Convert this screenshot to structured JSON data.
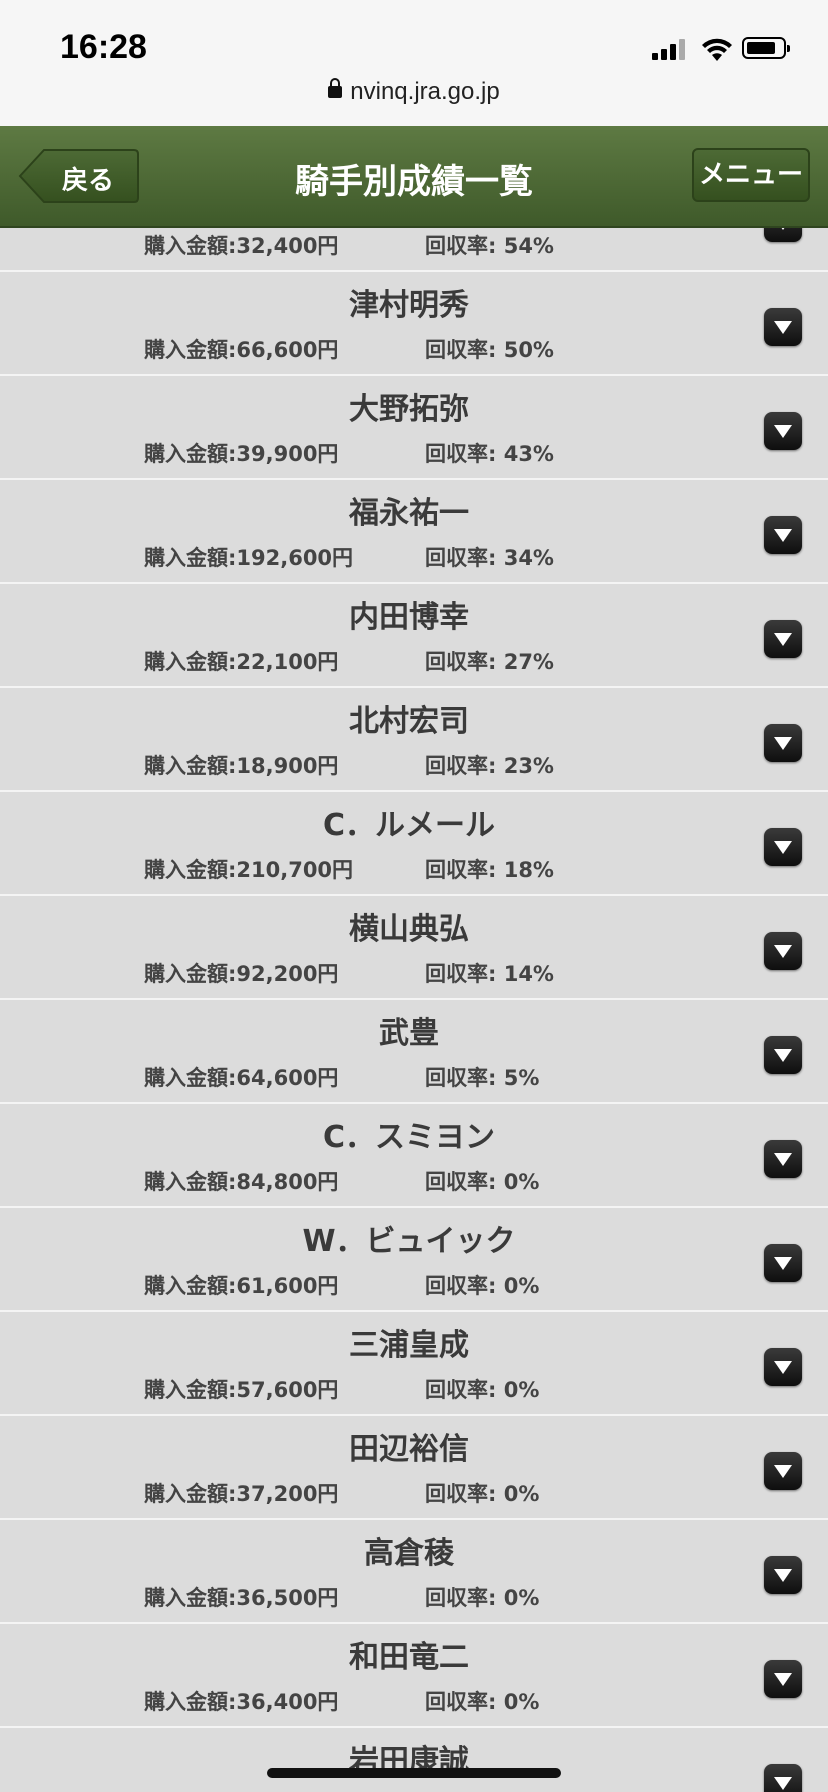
{
  "status_bar": {
    "time": "16:28",
    "url": "nvinq.jra.go.jp"
  },
  "nav": {
    "back_label": "戻る",
    "title": "騎手別成績一覧",
    "menu_label": "メニュー"
  },
  "rows": [
    {
      "name": "",
      "amount": "購入金額:32,400円",
      "rate": "回収率: 54%"
    },
    {
      "name": "津村明秀",
      "amount": "購入金額:66,600円",
      "rate": "回収率: 50%"
    },
    {
      "name": "大野拓弥",
      "amount": "購入金額:39,900円",
      "rate": "回収率: 43%"
    },
    {
      "name": "福永祐一",
      "amount": "購入金額:192,600円",
      "rate": "回収率: 34%"
    },
    {
      "name": "内田博幸",
      "amount": "購入金額:22,100円",
      "rate": "回収率: 27%"
    },
    {
      "name": "北村宏司",
      "amount": "購入金額:18,900円",
      "rate": "回収率: 23%"
    },
    {
      "name": "C．ルメール",
      "amount": "購入金額:210,700円",
      "rate": "回収率: 18%"
    },
    {
      "name": "横山典弘",
      "amount": "購入金額:92,200円",
      "rate": "回収率: 14%"
    },
    {
      "name": "武豊",
      "amount": "購入金額:64,600円",
      "rate": "回収率: 5%"
    },
    {
      "name": "C．スミヨン",
      "amount": "購入金額:84,800円",
      "rate": "回収率: 0%"
    },
    {
      "name": "W．ビュイック",
      "amount": "購入金額:61,600円",
      "rate": "回収率: 0%"
    },
    {
      "name": "三浦皇成",
      "amount": "購入金額:57,600円",
      "rate": "回収率: 0%"
    },
    {
      "name": "田辺裕信",
      "amount": "購入金額:37,200円",
      "rate": "回収率: 0%"
    },
    {
      "name": "高倉稜",
      "amount": "購入金額:36,500円",
      "rate": "回収率: 0%"
    },
    {
      "name": "和田竜二",
      "amount": "購入金額:36,400円",
      "rate": "回収率: 0%"
    },
    {
      "name": "岩田康誠",
      "amount": "",
      "rate": ""
    }
  ]
}
